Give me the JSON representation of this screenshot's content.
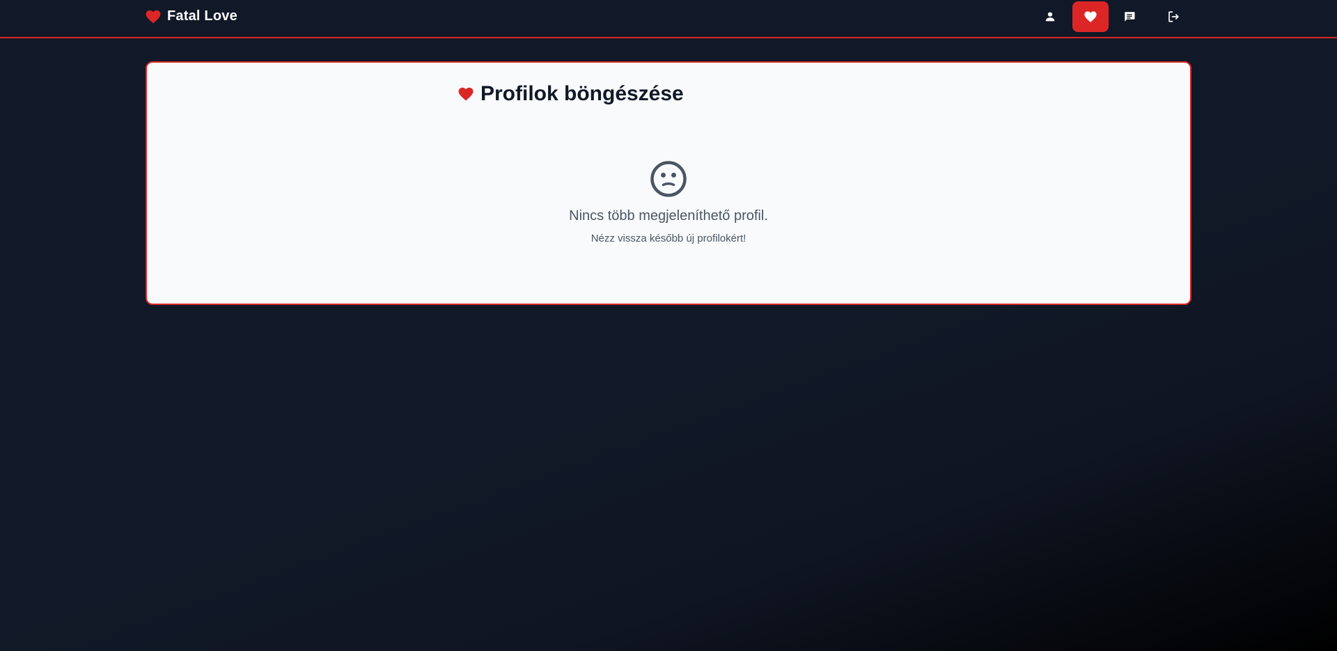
{
  "brand": {
    "name": "Fatal Love",
    "icon": "heart-icon"
  },
  "nav": {
    "items": [
      {
        "id": "profile",
        "icon": "user-icon",
        "active": false
      },
      {
        "id": "browse",
        "icon": "heart-icon",
        "active": true
      },
      {
        "id": "messages",
        "icon": "chat-icon",
        "active": false
      },
      {
        "id": "logout",
        "icon": "logout-icon",
        "active": false
      }
    ]
  },
  "main": {
    "title": "Profilok böngészése",
    "title_icon": "heart-icon",
    "empty_icon": "sad-face-icon",
    "empty_message": "Nincs több megjeleníthető profil.",
    "empty_hint": "Nézz vissza később új profilokért!"
  },
  "colors": {
    "accent": "#dc2626",
    "navbar_bg": "#111827",
    "card_bg": "#f8fafc",
    "text_muted": "#4b5563"
  }
}
